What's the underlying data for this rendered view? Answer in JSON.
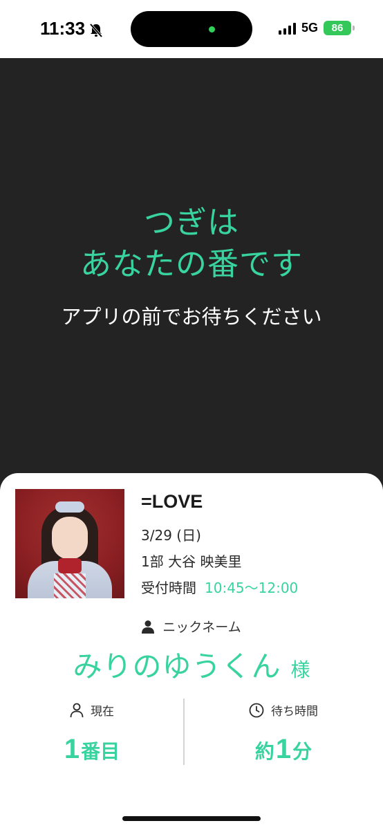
{
  "status_bar": {
    "time": "11:33",
    "network": "5G",
    "battery": "86",
    "accent_color": "#34c759"
  },
  "hero": {
    "title_line1": "つぎは",
    "title_line2": "あなたの番です",
    "subtitle": "アプリの前でお待ちください",
    "accent_color": "#38d39f"
  },
  "event": {
    "title": "=LOVE",
    "date": "3/29 (日)",
    "part_member": "1部  大谷 映美里",
    "reception_label": "受付時間",
    "reception_time": "10:45～12:00"
  },
  "nickname": {
    "label": "ニックネーム",
    "value": "みりのゆうくん",
    "honorific": "様"
  },
  "stats": {
    "current_label": "現在",
    "current_value": "1",
    "current_unit": "番目",
    "wait_label": "待ち時間",
    "wait_prefix": "約",
    "wait_value": "1",
    "wait_unit": "分"
  },
  "icons": {
    "notifications": "bell-slash-icon",
    "person": "person-icon",
    "clock": "clock-icon"
  }
}
